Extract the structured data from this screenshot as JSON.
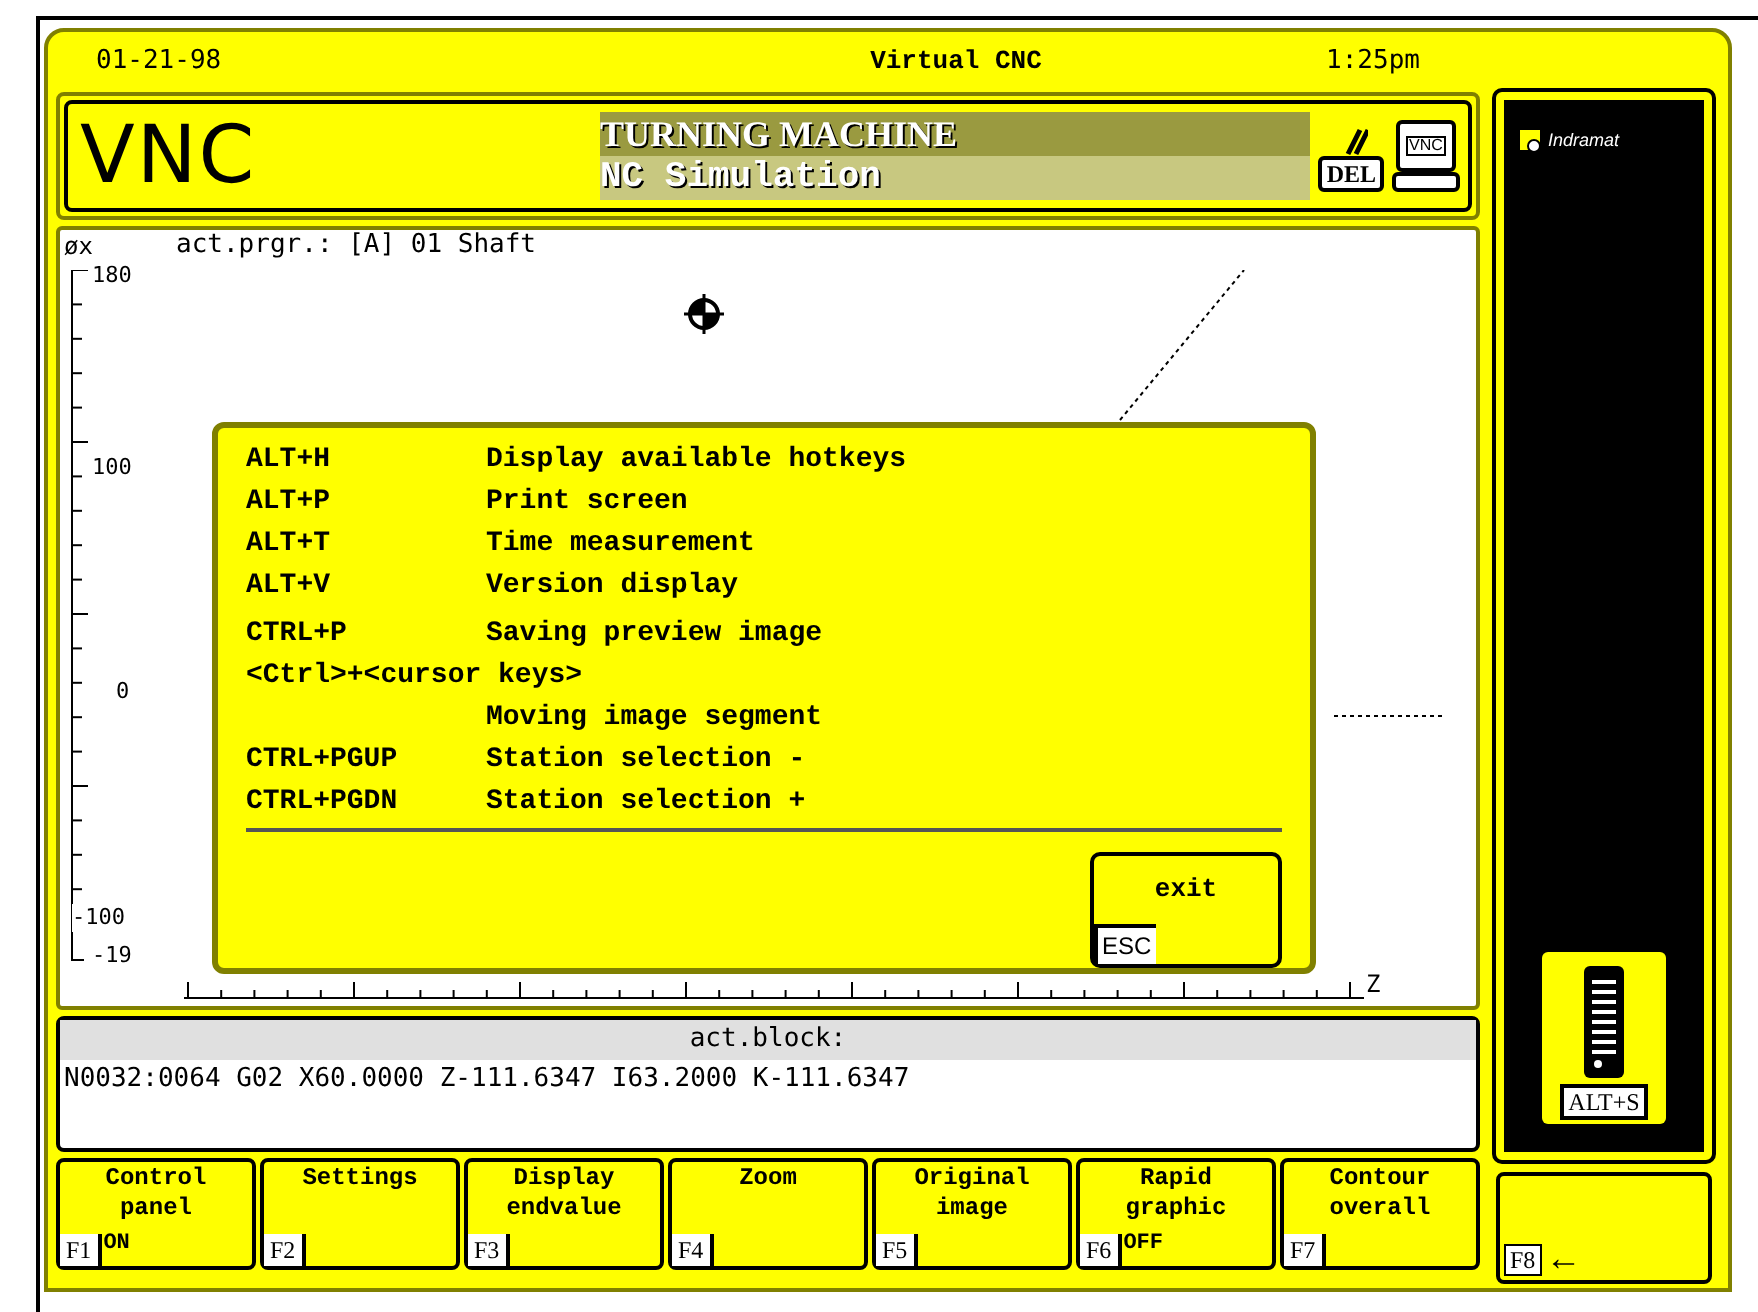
{
  "top_bar": {
    "date": "01-21-98",
    "title": "Virtual CNC",
    "time": "1:25pm"
  },
  "header": {
    "logo": "VNC",
    "machine": "TURNING MACHINE",
    "mode": "NC Simulation",
    "key": "DEL",
    "monitor_label": "VNC"
  },
  "graph": {
    "axis_label": "øx",
    "program": "act.prgr.: [A] 01 Shaft",
    "y_labels": [
      "180",
      "100",
      "0",
      "-100",
      "-19"
    ],
    "z_label": "Z"
  },
  "dialog": {
    "rows": [
      {
        "key": "ALT+H",
        "action": "Display available hotkeys"
      },
      {
        "key": "ALT+P",
        "action": "Print screen"
      },
      {
        "key": "ALT+T",
        "action": "Time measurement"
      },
      {
        "key": "ALT+V",
        "action": "Version display"
      },
      {
        "key": "CTRL+P",
        "action": "Saving preview image"
      },
      {
        "key": "<Ctrl>+<cursor keys>"
      },
      {
        "action": "Moving image segment"
      },
      {
        "key": "CTRL+PGUP",
        "action": "Station selection -"
      },
      {
        "key": "CTRL+PGDN",
        "action": "Station selection +"
      }
    ],
    "exit": {
      "label": "exit",
      "key": "ESC"
    }
  },
  "block": {
    "title": "act.block:",
    "text": "N0032:0064 G02 X60.0000 Z-111.6347 I63.2000 K-111.6347"
  },
  "function_keys": [
    {
      "label": "Control\npanel",
      "key": "F1",
      "state": "ON"
    },
    {
      "label": "Settings",
      "key": "F2"
    },
    {
      "label": "Display\nendvalue",
      "key": "F3"
    },
    {
      "label": "Zoom",
      "key": "F4"
    },
    {
      "label": "Original\nimage",
      "key": "F5"
    },
    {
      "label": "Rapid\ngraphic",
      "key": "F6",
      "state": "OFF"
    },
    {
      "label": "Contour\noverall",
      "key": "F7"
    }
  ],
  "side_panel": {
    "brand": "Indramat",
    "button": "ALT+S"
  },
  "f8": {
    "key": "F8",
    "arrow": "←"
  }
}
